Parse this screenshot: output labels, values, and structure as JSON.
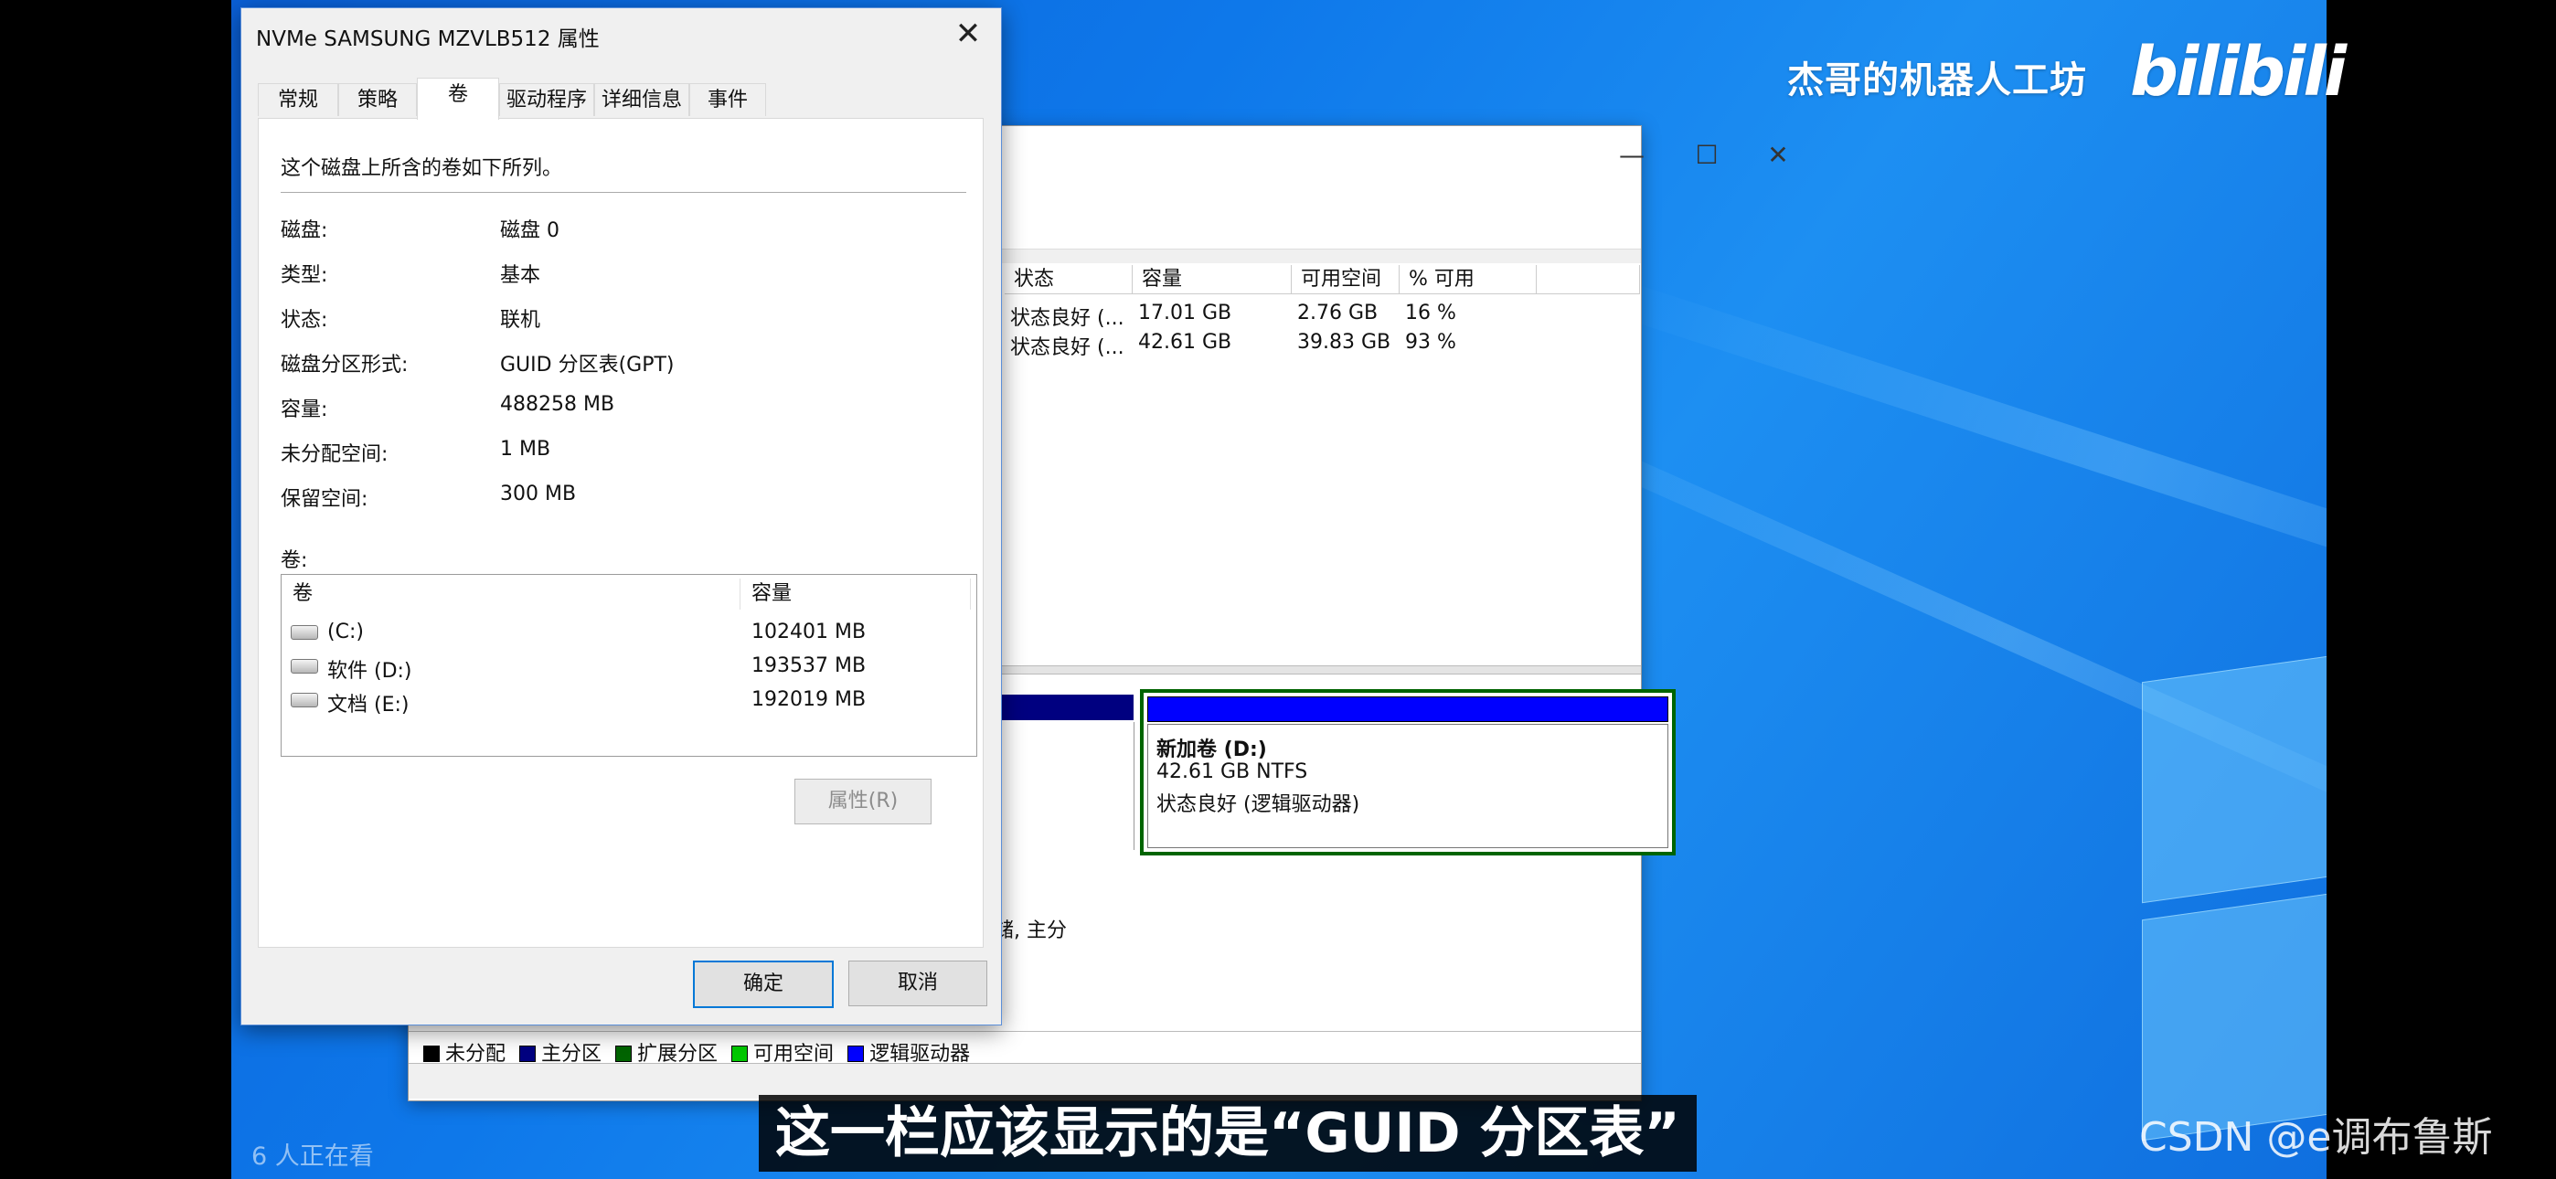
{
  "dialog": {
    "title": "NVMe SAMSUNG MZVLB512 属性",
    "tabs": [
      "常规",
      "策略",
      "卷",
      "驱动程序",
      "详细信息",
      "事件"
    ],
    "intro": "这个磁盘上所含的卷如下所列。",
    "fields": [
      {
        "label": "磁盘:",
        "value": "磁盘 0"
      },
      {
        "label": "类型:",
        "value": "基本"
      },
      {
        "label": "状态:",
        "value": "联机"
      },
      {
        "label": "磁盘分区形式:",
        "value": "GUID 分区表(GPT)"
      },
      {
        "label": "容量:",
        "value": "488258 MB"
      },
      {
        "label": "未分配空间:",
        "value": "1 MB"
      },
      {
        "label": "保留空间:",
        "value": "300 MB"
      }
    ],
    "volumes_label": "卷:",
    "volume_columns": [
      "卷",
      "容量"
    ],
    "volumes": [
      {
        "name": "(C:)",
        "size": "102401 MB"
      },
      {
        "name": "软件 (D:)",
        "size": "193537 MB"
      },
      {
        "name": "文档 (E:)",
        "size": "192019 MB"
      }
    ],
    "properties_button": "属性(R)",
    "ok_button": "确定",
    "cancel_button": "取消"
  },
  "disk_mgmt": {
    "columns": [
      "状态",
      "容量",
      "可用空间",
      "% 可用"
    ],
    "rows": [
      [
        "状态良好 (...",
        "17.01 GB",
        "2.76 GB",
        "16 %"
      ],
      [
        "状态良好 (...",
        "42.61 GB",
        "39.83 GB",
        "93 %"
      ]
    ],
    "partial_text": "储, 主分",
    "partition": {
      "name": "新加卷  (D:)",
      "size": "42.61 GB NTFS",
      "status": "状态良好 (逻辑驱动器)"
    },
    "legend": [
      {
        "label": "未分配",
        "color": "#000000"
      },
      {
        "label": "主分区",
        "color": "#000080"
      },
      {
        "label": "扩展分区",
        "color": "#006400"
      },
      {
        "label": "可用空间",
        "color": "#00c800"
      },
      {
        "label": "逻辑驱动器",
        "color": "#0000ff"
      }
    ]
  },
  "overlay": {
    "watermark": "杰哥的机器人工坊",
    "bilibili": "bilibili",
    "viewers": "6 人正在看",
    "subtitle": "这一栏应该显示的是“GUID 分区表”",
    "csdn": "CSDN @e调布鲁斯"
  }
}
